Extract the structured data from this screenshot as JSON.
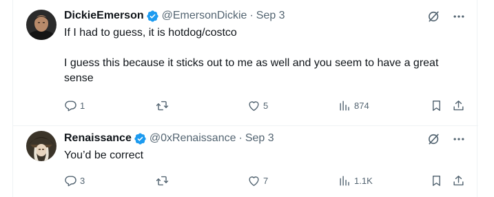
{
  "tweets": [
    {
      "name": "DickieEmerson",
      "handle": "@EmersonDickie",
      "separator": "·",
      "date": "Sep 3",
      "paragraphs": [
        "If I had to guess, it is hotdog/costco",
        "I guess this because it sticks out to me as well and you seem to have a great sense"
      ],
      "replies": "1",
      "reposts": "",
      "likes": "5",
      "views": "874"
    },
    {
      "name": "Renaissance",
      "handle": "@0xRenaissance",
      "separator": "·",
      "date": "Sep 3",
      "paragraphs": [
        "You’d be correct"
      ],
      "replies": "3",
      "reposts": "",
      "likes": "7",
      "views": "1.1K"
    }
  ],
  "colors": {
    "text": "#0f1419",
    "secondary": "#536471",
    "verified": "#1d9bf0",
    "border": "#eff3f4"
  },
  "icons": [
    "verified-badge-icon",
    "grok-icon",
    "more-icon",
    "reply-icon",
    "retweet-icon",
    "like-icon",
    "views-icon",
    "bookmark-icon",
    "share-icon"
  ]
}
